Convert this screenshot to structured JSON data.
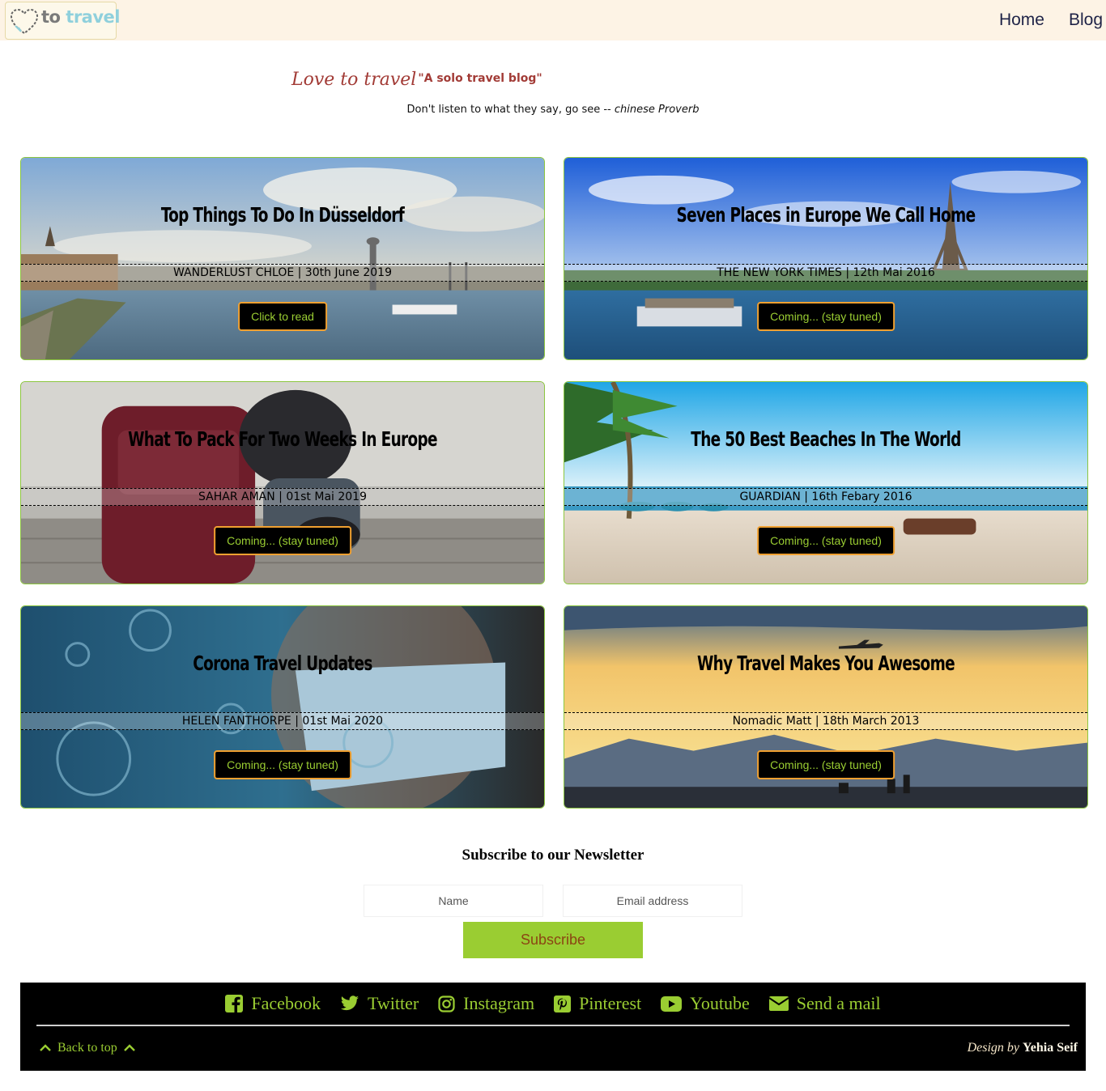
{
  "nav": {
    "logo": {
      "word1": "to",
      "word2": "travel"
    },
    "links": [
      "Home",
      "Blog"
    ]
  },
  "hero": {
    "brand": "Love to travel",
    "subtitle": "\"A solo travel blog\"",
    "quote": "Don't listen to what they say, go see --",
    "quote_source": "chinese Proverb"
  },
  "cards": [
    {
      "title": "Top Things To Do In Düsseldorf",
      "meta": "WANDERLUST CHLOE | 30th June 2019",
      "button": "Click to read",
      "scene": "city-river"
    },
    {
      "title": "Seven Places in Europe We Call Home",
      "meta": "THE NEW YORK TIMES | 12th Mai 2016",
      "button": "Coming... (stay tuned)",
      "scene": "paris-seine"
    },
    {
      "title": "What To Pack For Two Weeks In Europe",
      "meta": "SAHAR AMAN | 01st Mai 2019",
      "button": "Coming... (stay tuned)",
      "scene": "backpack"
    },
    {
      "title": "The 50 Best Beaches In The World",
      "meta": "GUARDIAN | 16th Febary 2016",
      "button": "Coming... (stay tuned)",
      "scene": "beach"
    },
    {
      "title": "Corona Travel Updates",
      "meta": "HELEN FANTHORPE | 01st Mai 2020",
      "button": "Coming... (stay tuned)",
      "scene": "mask-virus"
    },
    {
      "title": "Why Travel Makes You Awesome",
      "meta": "Nomadic Matt | 18th March 2013",
      "button": "Coming... (stay tuned)",
      "scene": "sunset-plane"
    }
  ],
  "newsletter": {
    "title": "Subscribe to our Newsletter",
    "name_placeholder": "Name",
    "email_placeholder": "Email address",
    "button": "Subscribe"
  },
  "footer": {
    "social": [
      {
        "label": "Facebook",
        "icon": "facebook-icon"
      },
      {
        "label": "Twitter",
        "icon": "twitter-icon"
      },
      {
        "label": "Instagram",
        "icon": "instagram-icon"
      },
      {
        "label": "Pinterest",
        "icon": "pinterest-icon"
      },
      {
        "label": "Youtube",
        "icon": "youtube-icon"
      },
      {
        "label": "Send a mail",
        "icon": "mail-icon"
      }
    ],
    "back_to_top": "Back to top",
    "credit_design": "Design",
    "credit_by": "by",
    "credit_name": "Yehia Seif"
  },
  "colors": {
    "accent_green": "#9acd32",
    "button_border": "#f0a030",
    "brand_red": "#a23b36",
    "nav_bg": "#fdf3e5"
  }
}
